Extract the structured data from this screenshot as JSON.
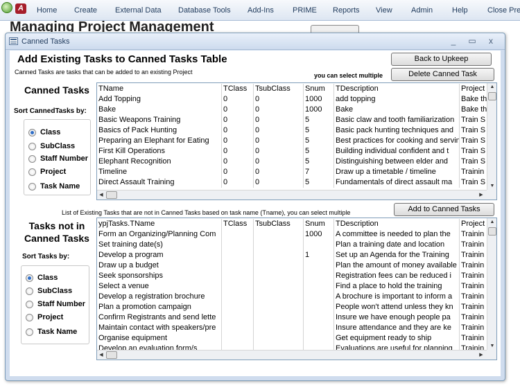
{
  "menu": [
    "Home",
    "Create",
    "External Data",
    "Database Tools",
    "Add-Ins",
    "PRIME",
    "Reports",
    "View",
    "Admin",
    "Help",
    "Close Prev"
  ],
  "background_title": "Managing Project Management",
  "window": {
    "title": "Canned Tasks",
    "minimize": "_",
    "maximize": "▭",
    "close": "x"
  },
  "heading": "Add Existing Tasks to Canned Tasks Table",
  "subtext": "Canned Tasks are tasks that can be added to an existing Project",
  "select_multiple": "you can select multiple",
  "buttons": {
    "back": "Back to Upkeep",
    "delete": "Delete Canned Task",
    "add": "Add to Canned Tasks"
  },
  "canned_section": {
    "title": "Canned Tasks",
    "sort_label": "Sort CannedTasks by:",
    "options": [
      {
        "label": "Class",
        "checked": true
      },
      {
        "label": "SubClass",
        "checked": false
      },
      {
        "label": "Staff Number",
        "checked": false
      },
      {
        "label": "Project",
        "checked": false
      },
      {
        "label": "Task Name",
        "checked": false
      }
    ]
  },
  "canned_list": {
    "columns": [
      "TName",
      "TClass",
      "TsubClass",
      "Snum",
      "TDescription",
      "Project"
    ],
    "rows": [
      [
        "Add Topping",
        "0",
        "0",
        "1000",
        "add topping",
        "Bake th"
      ],
      [
        "Bake",
        "0",
        "0",
        "1000",
        "Bake",
        "Bake th"
      ],
      [
        "Basic Weapons Training",
        "0",
        "0",
        "5",
        "Basic claw and tooth familiarization",
        "Train S"
      ],
      [
        "Basics of Pack Hunting",
        "0",
        "0",
        "5",
        "Basic pack hunting techniques and",
        "Train S"
      ],
      [
        "Preparing an Elephant for Eating",
        "0",
        "0",
        "5",
        "Best practices for cooking and serving",
        "Train S"
      ],
      [
        "First Kill Operations",
        "0",
        "0",
        "5",
        "Building individual confident and t",
        "Train S"
      ],
      [
        "Elephant Recognition",
        "0",
        "0",
        "5",
        "Distinguishing between elder and",
        "Train S"
      ],
      [
        "Timeline",
        "0",
        "0",
        "7",
        "Draw up a timetable / timeline",
        "Trainin"
      ],
      [
        "Direct Assault Training",
        "0",
        "0",
        "5",
        "Fundamentals of direct assault ma",
        "Train S"
      ]
    ]
  },
  "existing_hint": "List of Existing Tasks  that are not in Canned Tasks based on task name (Tname), you can select multiple",
  "tasks_section": {
    "title_line1": "Tasks not in",
    "title_line2": "Canned Tasks",
    "sort_label": "Sort Tasks by:",
    "options": [
      {
        "label": "Class",
        "checked": true
      },
      {
        "label": "SubClass",
        "checked": false
      },
      {
        "label": "Staff Number",
        "checked": false
      },
      {
        "label": "Project",
        "checked": false
      },
      {
        "label": "Task Name",
        "checked": false
      }
    ]
  },
  "tasks_list": {
    "columns": [
      "ypjTasks.TName",
      "TClass",
      "TsubClass",
      "Snum",
      "TDescription",
      "Project"
    ],
    "rows": [
      [
        "Form an Organizing/Planning Com",
        "",
        "",
        "1000",
        "A committee is needed to plan the",
        "Trainin"
      ],
      [
        "Set training date(s)",
        "",
        "",
        "",
        "Plan a training date and location",
        "Trainin"
      ],
      [
        "Develop a program",
        "",
        "",
        "1",
        "Set up an Agenda for the Training",
        "Trainin"
      ],
      [
        "Draw up a budget",
        "",
        "",
        "",
        "Plan the amount of money available",
        "Trainin"
      ],
      [
        "Seek sponsorships",
        "",
        "",
        "",
        "Registration fees can be reduced i",
        "Trainin"
      ],
      [
        "Select a venue",
        "",
        "",
        "",
        "Find a place to hold the training",
        "Trainin"
      ],
      [
        "Develop a registration brochure",
        "",
        "",
        "",
        "A brochure is important to inform a",
        "Trainin"
      ],
      [
        "Plan a promotion campaign",
        "",
        "",
        "",
        "People won't attend unless they kn",
        "Trainin"
      ],
      [
        "Confirm Registrants and send lette",
        "",
        "",
        "",
        "Insure we have enough people pa",
        "Trainin"
      ],
      [
        "Maintain contact with speakers/pre",
        "",
        "",
        "",
        "Insure attendance and they are ke",
        "Trainin"
      ],
      [
        "Organise equipment",
        "",
        "",
        "",
        "Get equipment ready to ship",
        "Trainin"
      ],
      [
        "Develop an evaluation form/s",
        "",
        "",
        "",
        "Evaluations are useful for planning",
        "Trainin"
      ]
    ]
  }
}
